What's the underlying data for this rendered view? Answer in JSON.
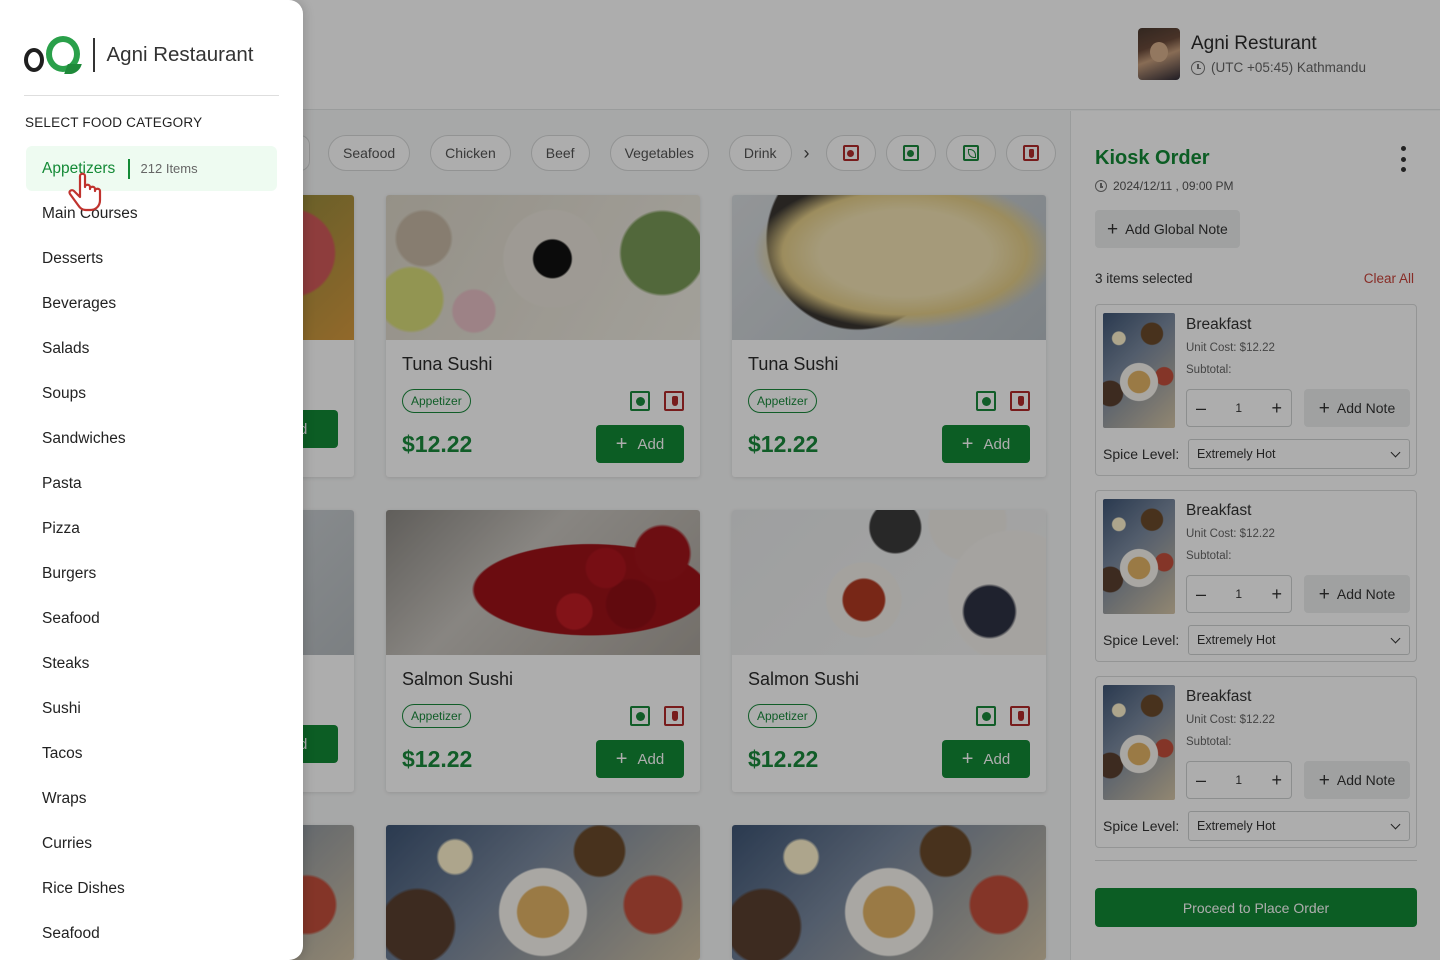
{
  "drawer": {
    "brand_name": "Agni Restaurant",
    "category_heading": "SELECT FOOD CATEGORY",
    "categories": [
      {
        "label": "Appetizers",
        "count": "212 Items",
        "active": true
      },
      {
        "label": "Main Courses"
      },
      {
        "label": "Desserts"
      },
      {
        "label": "Beverages"
      },
      {
        "label": "Salads"
      },
      {
        "label": "Soups"
      },
      {
        "label": "Sandwiches"
      },
      {
        "label": "Pasta"
      },
      {
        "label": "Pizza"
      },
      {
        "label": "Burgers"
      },
      {
        "label": "Seafood"
      },
      {
        "label": "Steaks"
      },
      {
        "label": "Sushi"
      },
      {
        "label": "Tacos"
      },
      {
        "label": "Wraps"
      },
      {
        "label": "Curries"
      },
      {
        "label": "Rice Dishes"
      },
      {
        "label": "Seafood"
      }
    ]
  },
  "header": {
    "user_name": "Agni Resturant",
    "timezone": "(UTC +05:45) Kathmandu"
  },
  "filters": {
    "chips": [
      "Seafood",
      "Chicken",
      "Beef",
      "Vegetables",
      "Drink"
    ],
    "icon_chips": [
      "veg-red-icon",
      "veg-green-icon",
      "leaf-icon",
      "chili-icon"
    ]
  },
  "menu": {
    "cards": [
      {
        "title": "Tuna Sushi",
        "tag": "Appetizer",
        "price": "$12.22",
        "add_label": "Add",
        "image": "macarons"
      },
      {
        "title": "Tuna Sushi",
        "tag": "Appetizer",
        "price": "$12.22",
        "add_label": "Add",
        "image": "popcorn"
      },
      {
        "title": "Salmon Sushi",
        "tag": "Appetizer",
        "price": "$12.22",
        "add_label": "Add",
        "image": "cherries"
      },
      {
        "title": "Salmon Sushi",
        "tag": "Appetizer",
        "price": "$12.22",
        "add_label": "Add",
        "image": "spices"
      }
    ],
    "partial_add_label": "Add"
  },
  "order": {
    "title": "Kiosk Order",
    "datetime": "2024/12/11 , 09:00 PM",
    "global_note_label": "Add Global Note",
    "selected_count": "3 items selected",
    "clear_all_label": "Clear All",
    "items": [
      {
        "name": "Breakfast",
        "unit_cost": "Unit Cost: $12.22",
        "subtotal": "Subtotal:",
        "quantity": "1",
        "note_label": "Add Note",
        "spice_label": "Spice Level:",
        "spice_value": "Extremely Hot"
      },
      {
        "name": "Breakfast",
        "unit_cost": "Unit Cost: $12.22",
        "subtotal": "Subtotal:",
        "quantity": "1",
        "note_label": "Add Note",
        "spice_label": "Spice Level:",
        "spice_value": "Extremely Hot"
      },
      {
        "name": "Breakfast",
        "unit_cost": "Unit Cost: $12.22",
        "subtotal": "Subtotal:",
        "quantity": "1",
        "note_label": "Add Note",
        "spice_label": "Spice Level:",
        "spice_value": "Extremely Hot"
      }
    ],
    "proceed_label": "Proceed to Place Order"
  },
  "colors": {
    "brand_green": "#138a36",
    "active_bg": "#eefbf1",
    "danger": "#c9433a",
    "overlay": "rgba(0,0,0,0.32)"
  }
}
